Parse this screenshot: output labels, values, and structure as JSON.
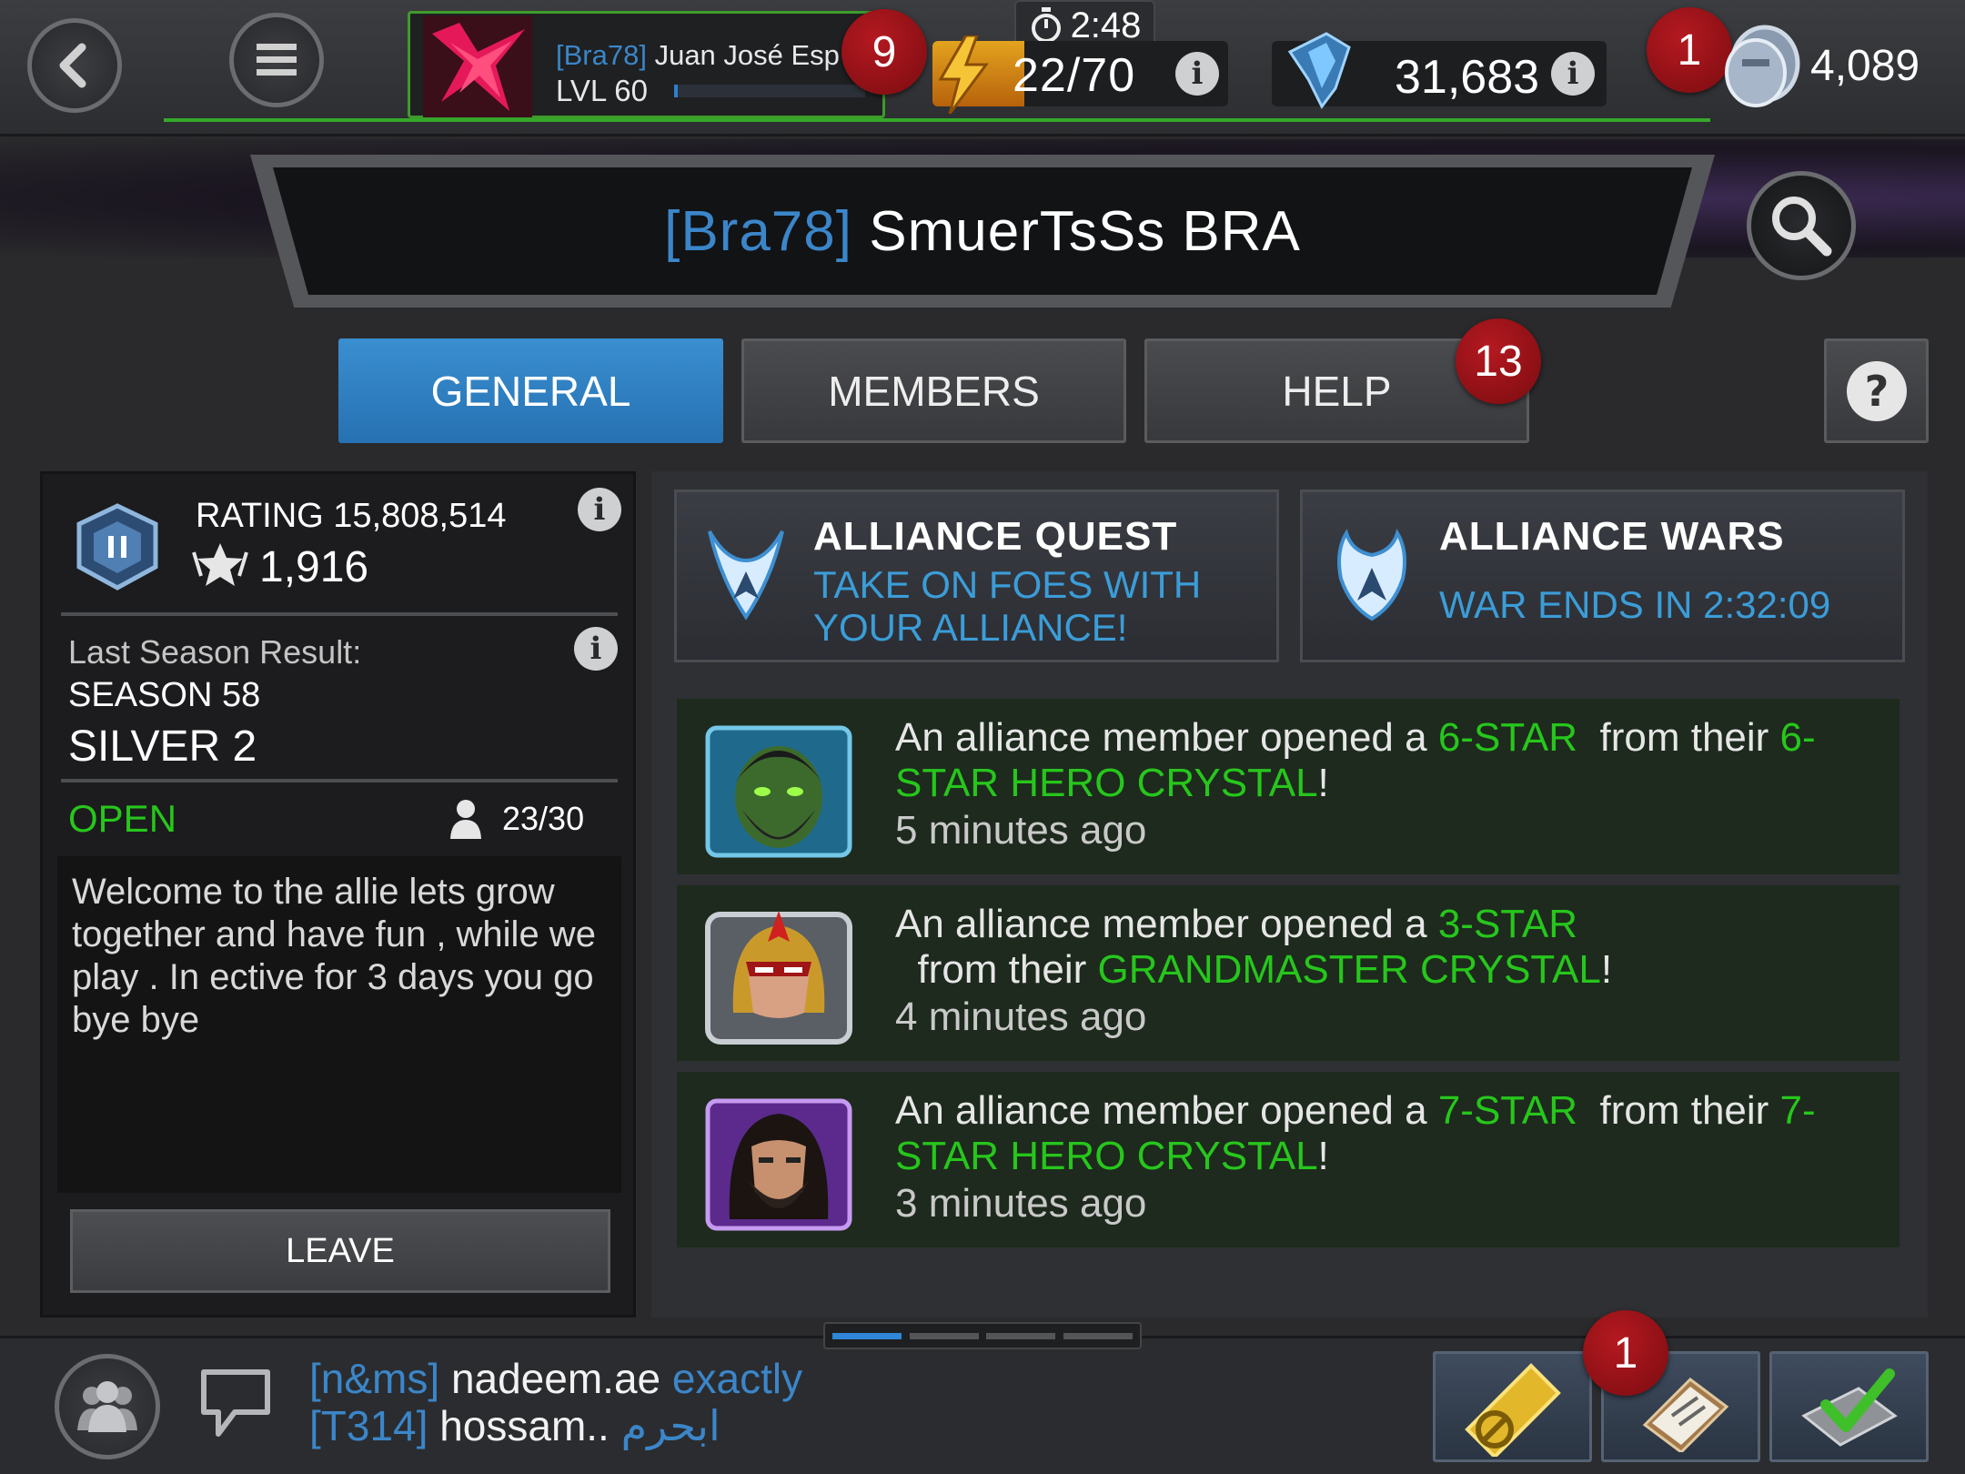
{
  "topbar": {
    "profile": {
      "tag": "[Bra78]",
      "name": "Juan José Esp",
      "level": "LVL 60",
      "xp_fraction": 0.02,
      "notification_count": "9"
    },
    "energy": {
      "timer": "2:48",
      "value": "22/70",
      "fill_fraction": 0.31
    },
    "units": {
      "value": "31,683"
    },
    "gold": {
      "value": "4,089",
      "notification_count": "1"
    }
  },
  "alliance": {
    "tag": "[Bra78]",
    "name": "SmuerTsSs BRA"
  },
  "tabs": [
    {
      "label": "GENERAL",
      "active": true
    },
    {
      "label": "MEMBERS",
      "active": false
    },
    {
      "label": "HELP",
      "active": false,
      "badge": "13"
    }
  ],
  "info_panel": {
    "rating_label": "RATING 15,808,514",
    "trophy_value": "1,916",
    "last_season_label": "Last Season Result:",
    "season_number": "SEASON 58",
    "season_tier": "SILVER 2",
    "status": "OPEN",
    "member_count": "23/30",
    "description": "Welcome to the allie lets grow together and have fun , while we play . In ective for 3 days you go bye bye",
    "leave_label": "LEAVE"
  },
  "modes": [
    {
      "title": "ALLIANCE QUEST",
      "subtitle": "TAKE ON FOES WITH YOUR ALLIANCE!"
    },
    {
      "title": "ALLIANCE WARS",
      "subtitle": "WAR ENDS IN 2:32:09"
    }
  ],
  "feed": [
    {
      "prefix": "An alliance member opened a ",
      "rarity": "6-STAR",
      "middle": "  from their ",
      "crystal": "6-STAR HERO CRYSTAL",
      "suffix": "!",
      "time": "5 minutes ago",
      "portrait": "green-hero-portrait"
    },
    {
      "prefix": "An alliance member opened a ",
      "rarity": "3-STAR",
      "middle": "  from their ",
      "crystal": "GRANDMASTER CRYSTAL",
      "suffix": "!",
      "time": "4 minutes ago",
      "portrait": "helmeted-hero-portrait"
    },
    {
      "prefix": "An alliance member opened a ",
      "rarity": "7-STAR",
      "middle": "  from their ",
      "crystal": "7-STAR HERO CRYSTAL",
      "suffix": "!",
      "time": "3 minutes ago",
      "portrait": "bearded-hero-portrait"
    }
  ],
  "pager": {
    "active_index": 0,
    "total": 4
  },
  "chat": [
    {
      "tag": "[n&ms]",
      "user": "nadeem.ae",
      "message": "exactly"
    },
    {
      "tag": "[T314]",
      "user": "hossam..",
      "message": "ابحرم"
    }
  ],
  "bottom_actions": {
    "quests_badge": "1"
  },
  "colors": {
    "accent_blue": "#2f86d6",
    "highlight_green": "#27c61c",
    "badge_red": "#a3141a",
    "energy_orange": "#e3a31e"
  }
}
